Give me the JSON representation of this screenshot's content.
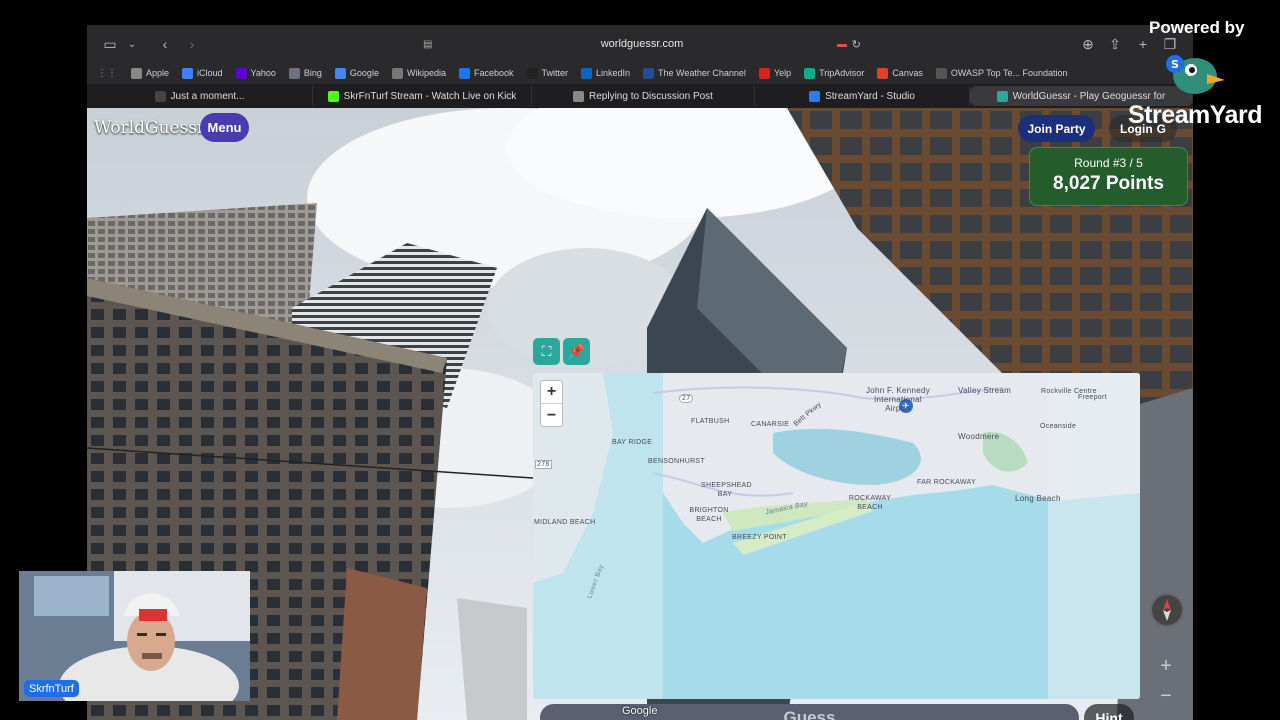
{
  "browser": {
    "url": "worldguessr.com",
    "bookmarks": [
      {
        "label": "Apple",
        "icon": "apple-icon",
        "color": "#888888"
      },
      {
        "label": "iCloud",
        "icon": "icloud-icon",
        "color": "#3b82f6"
      },
      {
        "label": "Yahoo",
        "icon": "yahoo-icon",
        "color": "#6001d2"
      },
      {
        "label": "Bing",
        "icon": "bing-icon",
        "color": "#6b7280"
      },
      {
        "label": "Google",
        "icon": "google-icon",
        "color": "#4285f4"
      },
      {
        "label": "Wikipedia",
        "icon": "wikipedia-icon",
        "color": "#777777"
      },
      {
        "label": "Facebook",
        "icon": "facebook-icon",
        "color": "#1877f2"
      },
      {
        "label": "Twitter",
        "icon": "twitter-icon",
        "color": "#222222"
      },
      {
        "label": "LinkedIn",
        "icon": "linkedin-icon",
        "color": "#0a66c2"
      },
      {
        "label": "The Weather Channel",
        "icon": "weather-channel-icon",
        "color": "#1f4e9a"
      },
      {
        "label": "Yelp",
        "icon": "yelp-icon",
        "color": "#d32323"
      },
      {
        "label": "TripAdvisor",
        "icon": "tripadvisor-icon",
        "color": "#00af87"
      },
      {
        "label": "Canvas",
        "icon": "canvas-icon",
        "color": "#e13f2b"
      },
      {
        "label": "OWASP Top Te... Foundation",
        "icon": "owasp-icon",
        "color": "#555555"
      }
    ],
    "tabs": [
      {
        "label": "Just a moment...",
        "icon": "loading-icon",
        "color": "#444444"
      },
      {
        "label": "SkrFnTurf Stream - Watch Live on Kick",
        "icon": "kick-icon",
        "color": "#53fc18"
      },
      {
        "label": "Replying to Discussion Post",
        "icon": "discussion-icon",
        "color": "#888888"
      },
      {
        "label": "StreamYard - Studio",
        "icon": "streamyard-icon",
        "color": "#2f7cf6"
      },
      {
        "label": "WorldGuessr - Play Geoguessr for",
        "icon": "globe-icon",
        "color": "#2aa89c"
      }
    ]
  },
  "game": {
    "logo": "WorldGuessr",
    "menu_label": "Menu",
    "join_party_label": "Join Party",
    "login_label": "Login",
    "round_label": "Round #3 / 5",
    "points_label": "8,027 Points",
    "guess_label": "Guess",
    "hint_label": "Hint",
    "google_mark": "Google",
    "map_zoom_in": "+",
    "map_zoom_out": "−",
    "sv_zoom_in": "+",
    "sv_zoom_out": "−",
    "map_labels": [
      "Valley Stream",
      "Rockville Centre",
      "Freeport",
      "John F. Kennedy International Airport",
      "FLATBUSH",
      "CANARSIE",
      "Belt Pkwy",
      "Woodmere",
      "Oceanside",
      "BAY RIDGE",
      "BENSONHURST",
      "SHEEPSHEAD BAY",
      "FAR ROCKAWAY",
      "Long Beach",
      "ROCKAWAY BEACH",
      "BRIGHTON BEACH",
      "Jamaica Bay",
      "BREEZY POINT",
      "MIDLAND BEACH",
      "27",
      "278",
      "Lower Bay"
    ]
  },
  "overlay": {
    "powered_by": "Powered by",
    "streamyard_logo": "StreamYard",
    "webcam_name": "SkrfnTurf"
  }
}
